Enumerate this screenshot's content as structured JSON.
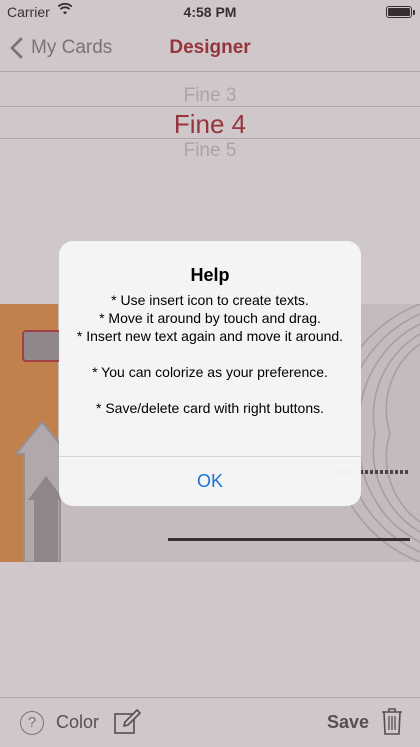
{
  "status_bar": {
    "carrier": "Carrier",
    "time": "4:58 PM",
    "wifi_icon": "wifi-icon",
    "battery_icon": "battery-icon"
  },
  "nav": {
    "back_label": "My Cards",
    "back_icon": "chevron-left-icon",
    "title": "Designer",
    "title_color": "#a11d22"
  },
  "font_picker": {
    "previous": "Fine 3",
    "selected": "Fine 4",
    "next": "Fine 5"
  },
  "toolbar": {
    "help_icon_glyph": "?",
    "color_label": "Color",
    "edit_icon": "edit-icon",
    "save_label": "Save",
    "trash_icon": "trash-icon"
  },
  "alert": {
    "title": "Help",
    "lines": [
      "* Use insert icon to create texts.",
      "* Move it around by touch and drag.",
      "* Insert new text again and move it around.",
      "",
      "* You can colorize as your preference.",
      "",
      "* Save/delete card with right buttons."
    ],
    "ok_label": "OK",
    "ok_color": "#1a73d9"
  },
  "colors": {
    "accent": "#a11d22",
    "canvas_orange": "#e8923a",
    "link_blue": "#1a73d9"
  }
}
